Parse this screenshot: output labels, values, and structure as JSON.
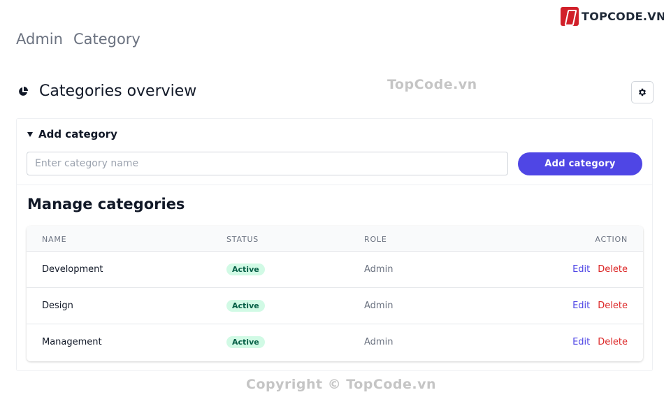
{
  "breadcrumb": [
    "Admin",
    "Category"
  ],
  "brand": {
    "logo_text": "TOPCODE.VN",
    "color": "#d1202a"
  },
  "watermarks": {
    "top": "TopCode.vn",
    "bottom": "Copyright © TopCode.vn"
  },
  "overview": {
    "title": "Categories overview",
    "icon": "pie-chart-icon"
  },
  "settings": {
    "icon": "gear-icon"
  },
  "add_section": {
    "summary": "Add category",
    "input_placeholder": "Enter category name",
    "input_value": "",
    "button_label": "Add category",
    "accent": "#4f46e5"
  },
  "manage": {
    "title": "Manage categories",
    "columns": [
      "NAME",
      "STATUS",
      "ROLE",
      "ACTION"
    ],
    "rows": [
      {
        "name": "Development",
        "status": "Active",
        "role": "Admin",
        "edit": "Edit",
        "delete": "Delete"
      },
      {
        "name": "Design",
        "status": "Active",
        "role": "Admin",
        "edit": "Edit",
        "delete": "Delete"
      },
      {
        "name": "Management",
        "status": "Active",
        "role": "Admin",
        "edit": "Edit",
        "delete": "Delete"
      }
    ]
  }
}
